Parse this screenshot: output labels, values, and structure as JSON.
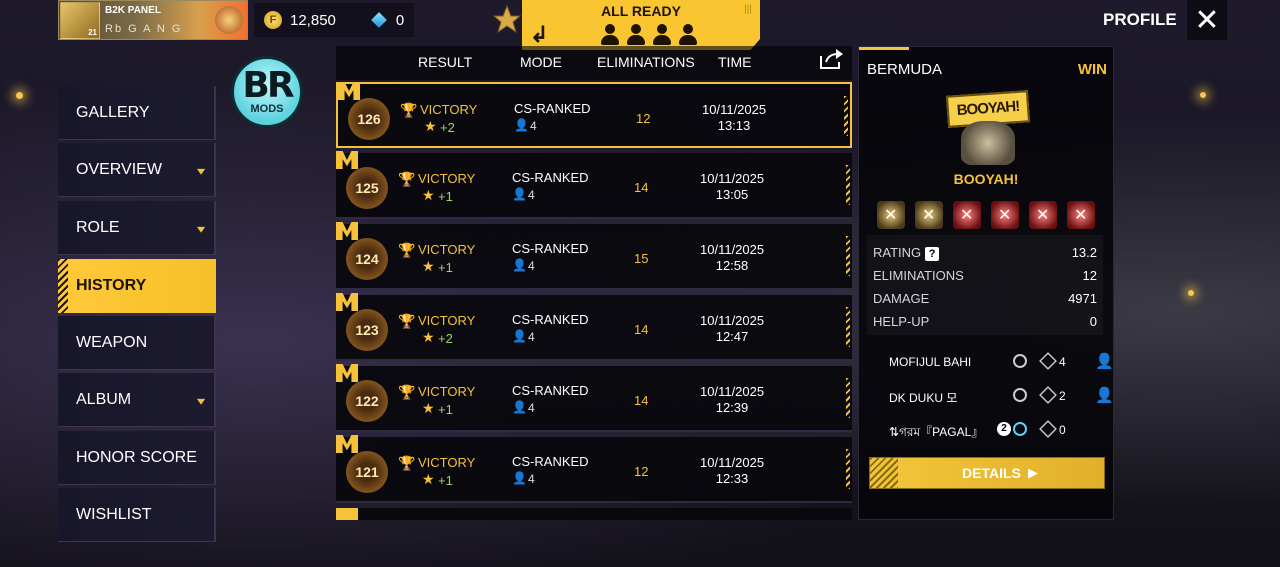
{
  "header": {
    "player_name": "B2K PANEL",
    "player_guild": "Rb G A N G",
    "level": "21",
    "coins": "12,850",
    "diamonds": "0",
    "all_ready": "ALL READY",
    "profile": "PROFILE"
  },
  "watermark": {
    "line1": "BR",
    "line2": "MODS"
  },
  "menu": [
    {
      "label": "GALLERY",
      "dropdown": false
    },
    {
      "label": "OVERVIEW",
      "dropdown": true
    },
    {
      "label": "ROLE",
      "dropdown": true
    },
    {
      "label": "HISTORY",
      "dropdown": false,
      "active": true
    },
    {
      "label": "WEAPON",
      "dropdown": false
    },
    {
      "label": "ALBUM",
      "dropdown": true
    },
    {
      "label": "HONOR SCORE",
      "dropdown": false
    },
    {
      "label": "WISHLIST",
      "dropdown": false
    }
  ],
  "table": {
    "columns": {
      "result": "RESULT",
      "mode": "MODE",
      "eliminations": "ELIMINATIONS",
      "time": "TIME"
    },
    "rows": [
      {
        "num": "126",
        "result": "VICTORY",
        "stars": "+2",
        "mode": "CS-RANKED",
        "players": "4",
        "elim": "12",
        "date": "10/11/2025",
        "time": "13:13"
      },
      {
        "num": "125",
        "result": "VICTORY",
        "stars": "+1",
        "mode": "CS-RANKED",
        "players": "4",
        "elim": "14",
        "date": "10/11/2025",
        "time": "13:05"
      },
      {
        "num": "124",
        "result": "VICTORY",
        "stars": "+1",
        "mode": "CS-RANKED",
        "players": "4",
        "elim": "15",
        "date": "10/11/2025",
        "time": "12:58"
      },
      {
        "num": "123",
        "result": "VICTORY",
        "stars": "+2",
        "mode": "CS-RANKED",
        "players": "4",
        "elim": "14",
        "date": "10/11/2025",
        "time": "12:47"
      },
      {
        "num": "122",
        "result": "VICTORY",
        "stars": "+1",
        "mode": "CS-RANKED",
        "players": "4",
        "elim": "14",
        "date": "10/11/2025",
        "time": "12:39"
      },
      {
        "num": "121",
        "result": "VICTORY",
        "stars": "+1",
        "mode": "CS-RANKED",
        "players": "4",
        "elim": "12",
        "date": "10/11/2025",
        "time": "12:33"
      }
    ]
  },
  "details": {
    "map": "BERMUDA",
    "outcome": "WIN",
    "booyah_art": "BOOYAH!",
    "booyah": "BOOYAH!",
    "stats": [
      {
        "key": "RATING",
        "value": "13.2",
        "help": "?"
      },
      {
        "key": "ELIMINATIONS",
        "value": "12"
      },
      {
        "key": "DAMAGE",
        "value": "4971"
      },
      {
        "key": "HELP-UP",
        "value": "0"
      }
    ],
    "team": [
      {
        "name": "MOFIJUL   BAHI",
        "kills": "4"
      },
      {
        "name": "DK   DUKU   모",
        "kills": "2"
      },
      {
        "name": "⇅গরম『PAGAL』",
        "badge": "2",
        "kills": "0"
      }
    ],
    "details_button": "DETAILS"
  },
  "colors": {
    "accent": "#f5c23a",
    "panel": "#08080c"
  }
}
